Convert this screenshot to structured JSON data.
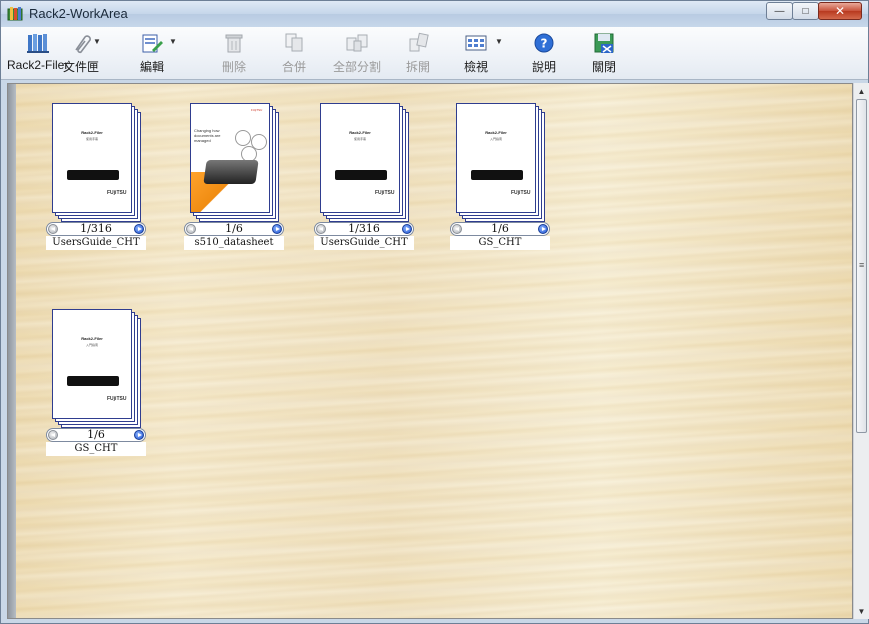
{
  "window": {
    "title": "Rack2-WorkArea",
    "controls": {
      "minimize": "—",
      "maximize": "□",
      "close": "✕"
    }
  },
  "toolbar": {
    "items": [
      {
        "label": "Rack2-Filer",
        "icon": "bookshelf-icon",
        "enabled": true
      },
      {
        "label": "文件匣",
        "icon": "paperclip-icon",
        "enabled": true,
        "dropdown": true
      },
      {
        "label": "編輯",
        "icon": "edit-document-icon",
        "enabled": true,
        "dropdown": true
      },
      {
        "label": "刪除",
        "icon": "trash-icon",
        "enabled": false
      },
      {
        "label": "合併",
        "icon": "merge-icon",
        "enabled": false
      },
      {
        "label": "全部分割",
        "icon": "split-all-icon",
        "enabled": false
      },
      {
        "label": "拆開",
        "icon": "unbind-icon",
        "enabled": false
      },
      {
        "label": "檢視",
        "icon": "view-grid-icon",
        "enabled": true,
        "dropdown": true
      },
      {
        "label": "說明",
        "icon": "help-icon",
        "enabled": true
      },
      {
        "label": "關閉",
        "icon": "close-app-icon",
        "enabled": true
      }
    ]
  },
  "documents": [
    {
      "name": "UsersGuide_CHT",
      "page": "1/316",
      "kind": "guide",
      "cover_title": "Rack2-Filer",
      "cover_sub": "使用手冊",
      "logo": "FUjiTSU"
    },
    {
      "name": "s510_datasheet",
      "page": "1/6",
      "kind": "datasheet",
      "cover_title": "Changing how documents are managed",
      "logo": "FUjiTSU"
    },
    {
      "name": "UsersGuide_CHT",
      "page": "1/316",
      "kind": "guide",
      "cover_title": "Rack2-Filer",
      "cover_sub": "使用手冊",
      "logo": "FUjiTSU"
    },
    {
      "name": "GS_CHT",
      "page": "1/6",
      "kind": "guide",
      "cover_title": "Rack2-Filer",
      "cover_sub": "入門指南",
      "logo": "FUjiTSU"
    },
    {
      "name": "GS_CHT",
      "page": "1/6",
      "kind": "guide",
      "cover_title": "Rack2-Filer",
      "cover_sub": "入門指南",
      "logo": "FUjiTSU"
    }
  ]
}
